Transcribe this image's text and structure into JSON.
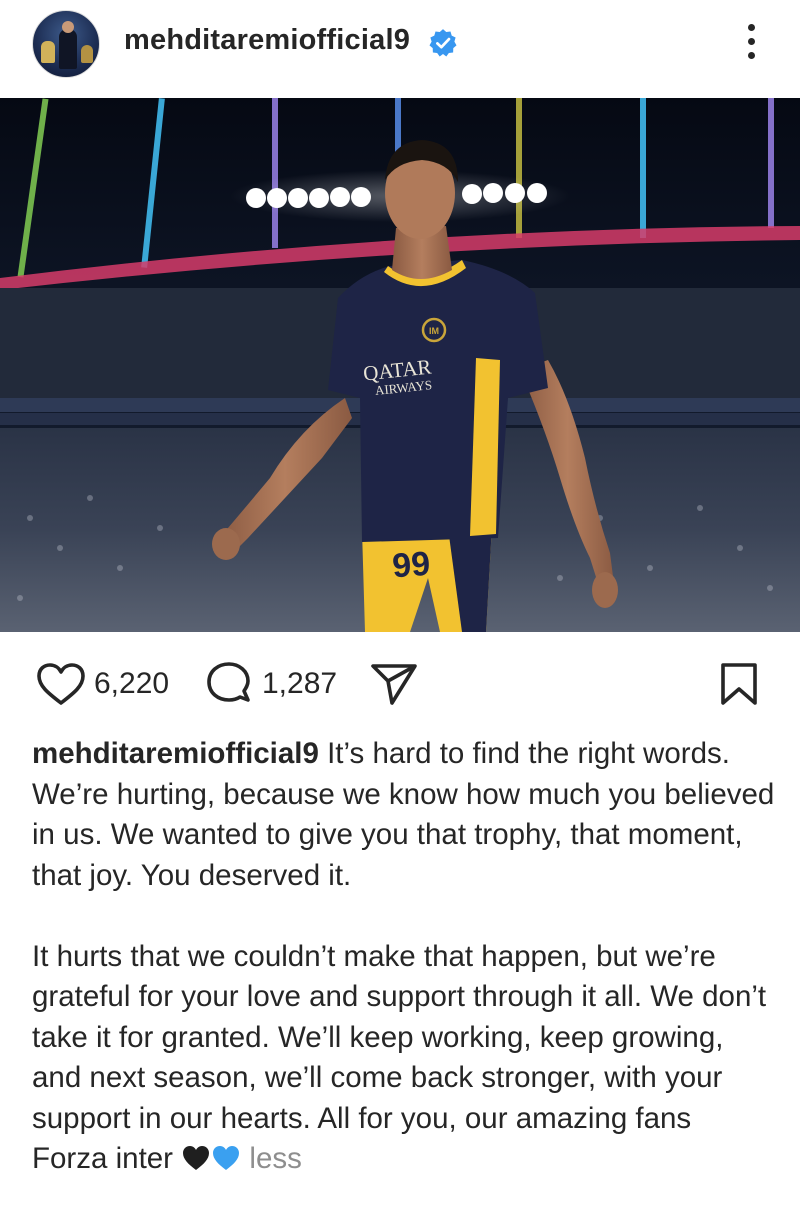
{
  "post": {
    "username": "mehditaremiofficial9",
    "verified": true,
    "likes": "6,220",
    "comments": "1,287",
    "caption_paragraph_1": "It’s hard to find the right words. We’re hurting, because we know how much you believed in us. We wanted to give you that trophy, that moment, that joy. You deserved it.",
    "caption_paragraph_2": "It hurts that we couldn’t make that happen, but we’re grateful for your love and support through it all. We don’t take it for granted. We’ll keep working, keep growing, and next season, we’ll come back stronger, with your support in our hearts. All for you, our amazing fans",
    "caption_last_line": "Forza inter",
    "caption_emojis": [
      "black-heart",
      "blue-heart"
    ],
    "less_label": "less"
  },
  "photo": {
    "jersey_sponsor_line_1": "QATAR",
    "jersey_sponsor_line_2": "AIRWAYS",
    "shorts_number": "99"
  },
  "icons": {
    "header_menu": "more-vertical-icon",
    "verified": "verified-badge-icon",
    "like": "heart-outline-icon",
    "comment": "comment-bubble-icon",
    "share": "send-paper-plane-icon",
    "save": "bookmark-outline-icon"
  },
  "colors": {
    "text": "#262626",
    "verified_blue": "#3897f0",
    "muted": "#8e8e8e",
    "jersey_navy": "#1e2446",
    "jersey_yellow": "#f2c230"
  }
}
